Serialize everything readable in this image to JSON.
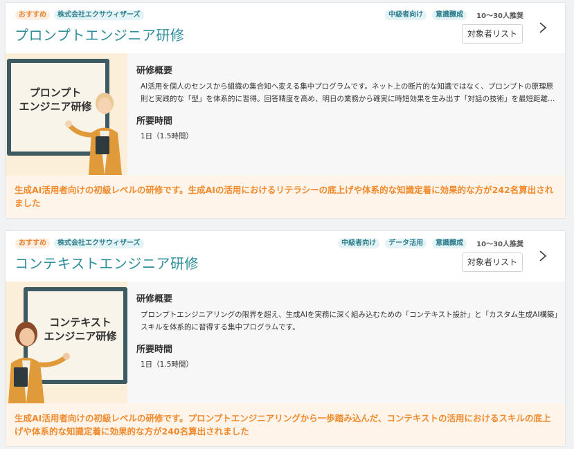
{
  "courses": [
    {
      "badge_recommended": "おすすめ",
      "provider": "株式会社エクサウィザーズ",
      "tags": [
        "中級者向け",
        "意識醸成"
      ],
      "recommended_size": "10〜30人推奨",
      "title": "プロンプトエンジニア研修",
      "target_button": "対象者リスト",
      "thumbnail_text": [
        "プロンプト",
        "エンジニア研修"
      ],
      "overview_heading": "研修概要",
      "overview": "AI活用を個人のセンスから組織の集合知へ変える集中プログラムです。ネット上の断片的な知識ではなく、プロンプトの原理原則と実践的な「型」を体系的に習得。回答精度を高め、明日の業務から確実に時短効果を生み出す「対話の技術」を最短距離で身につけます。",
      "duration_heading": "所要時間",
      "duration": "1日（1.5時間）",
      "note": "生成AI活用者向けの初級レベルの研修です。生成AIの活用におけるリテラシーの底上げや体系的な知識定着に効果的な方が242名算出されました"
    },
    {
      "badge_recommended": "おすすめ",
      "provider": "株式会社エクサウィザーズ",
      "tags": [
        "中級者向け",
        "データ活用",
        "意識醸成"
      ],
      "recommended_size": "10〜30人推奨",
      "title": "コンテキストエンジニア研修",
      "target_button": "対象者リスト",
      "thumbnail_text": [
        "コンテキスト",
        "エンジニア研修"
      ],
      "overview_heading": "研修概要",
      "overview": "プロンプトエンジニアリングの限界を超え、生成AIを実務に深く組み込むための「コンテキスト設計」と「カスタム生成AI構築」スキルを体系的に習得する集中プログラムです。",
      "duration_heading": "所要時間",
      "duration": "1日（1.5時間）",
      "note": "生成AI活用者向けの初級レベルの研修です。プロンプトエンジニアリングから一歩踏み込んだ、コンテキストの活用におけるスキルの底上げや体系的な知識定着に効果的な方が240名算出されました"
    }
  ]
}
